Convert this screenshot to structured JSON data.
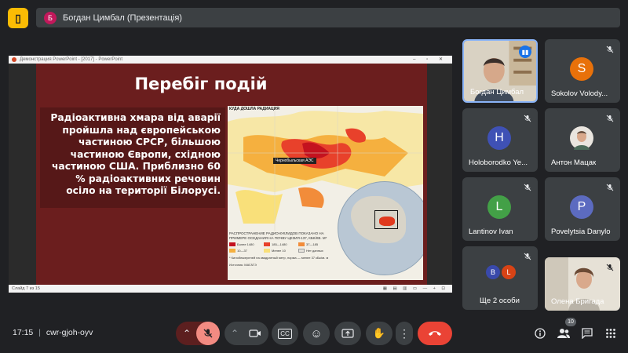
{
  "header": {
    "app_icon": "docs-icon",
    "presenter_initial": "Б",
    "presenter_title": "Богдан Цимбал (Презентація)"
  },
  "ppt": {
    "window_title": "Демонстрация PowerPoint - [2017]  -  PowerPoint",
    "window_controls": "– ▫ ✕",
    "status_text": "Слайд 7 из 15",
    "status_icons": "▦ ▤ ▥ ▭  —  + ⊡"
  },
  "slide": {
    "title": "Перебіг подій",
    "body": "Радіоактивна хмара від аварії пройшла над європейською частиною СРСР, більшою частиною Європи, східною частиною США. Приблизно 60 % радіоактивних речовин осіло на території Білорусі.",
    "map_header": "КУДА ДОШЛА РАДИАЦИЯ",
    "map_label": "Чернобыльская АЭС",
    "legend_title": "РАСПРОСТРАНЕНИЕ РАДИОНУКЛИДОВ ПОКАЗАНО НА ПРИМЕРЕ ОСЕДАНИЯ НА ПОЧВУ ЦЕЗИЯ-137, КБК/КВ. М*",
    "legend": [
      {
        "label": "Более 1480",
        "color": "#c4121f"
      },
      {
        "label": "185—1480",
        "color": "#e8412b"
      },
      {
        "label": "37—185",
        "color": "#f28c3a"
      },
      {
        "label": "10—37",
        "color": "#f5b03f"
      },
      {
        "label": "Менее 10",
        "color": "#f9e07a"
      },
      {
        "label": "Нет данных",
        "color": "#e6e3dc"
      }
    ],
    "legend_note": "* Килобеккерелей на квадратный метр, норма — менее 37 кБк/кв. м",
    "legend_source": "Источник: МАГАТЭ"
  },
  "participants": [
    {
      "name": "Богдан Цимбал",
      "video": true,
      "speaking": true
    },
    {
      "name": "Sokolov Volody...",
      "initial": "S",
      "color": "#e8710a",
      "muted": true
    },
    {
      "name": "",
      "video": true,
      "muted": true
    },
    {
      "name": "",
      "video": true,
      "muted": true
    },
    {
      "name": "Holoborodko Ye...",
      "initial": "H",
      "color": "#3f51b5",
      "muted": true
    },
    {
      "name": "Антон Мацак",
      "video": true,
      "muted": true
    },
    {
      "name": "Lantinov Ivan",
      "initial": "L",
      "color": "#43a047",
      "muted": true
    },
    {
      "name": "Povelytsia Danylo",
      "initial": "P",
      "color": "#5c6bc0",
      "muted": true
    },
    {
      "name": "Ще 2 особи",
      "initials": [
        "B",
        "L"
      ],
      "colors": [
        "#3949ab",
        "#d84315"
      ],
      "muted": true
    },
    {
      "name": "Олена Бригада",
      "video": true,
      "muted": true
    }
  ],
  "bottom": {
    "time": "17:15",
    "separator": "|",
    "meeting_code": "cwr-gjoh-oyv",
    "participant_count": "10"
  },
  "icons": {
    "chevron_up": "⌃",
    "mic_off": "✕",
    "camera": "▭",
    "captions": "CC",
    "emoji": "☺",
    "present": "⇪",
    "hand": "✋",
    "more": "⋮",
    "end_call": "☎",
    "info": "ⓘ",
    "people": "👥",
    "chat": "▤",
    "activities": "⁘"
  },
  "colors": {
    "background": "#202124",
    "tile": "#3c4043",
    "mic_off_button": "#f28b82",
    "end_call": "#ea4335",
    "slide_bg": "#6b1e1e"
  }
}
